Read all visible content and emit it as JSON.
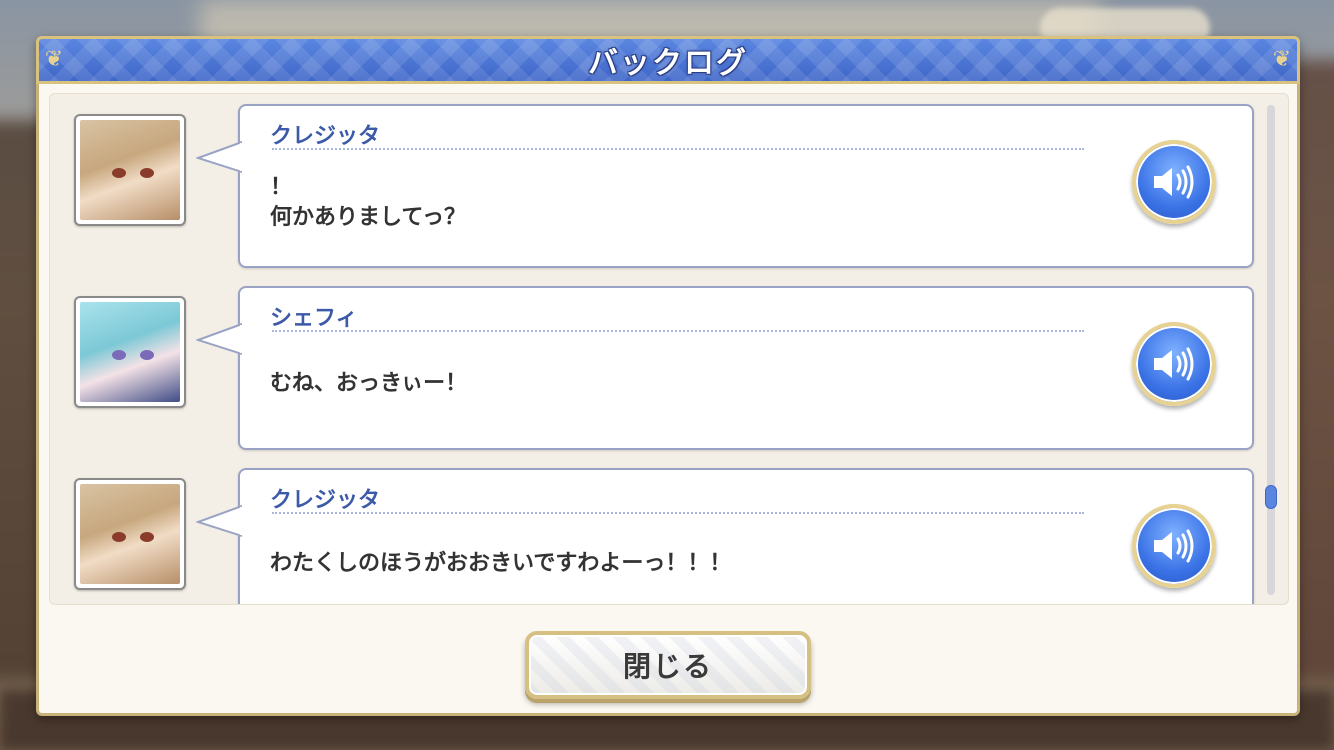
{
  "window": {
    "title": "バックログ",
    "close_label": "閉じる"
  },
  "entries": [
    {
      "speaker": "クレジッタ",
      "lines": [
        "！",
        "何かありましてっ？"
      ],
      "avatar": "kurejitta-portrait",
      "voice_icon": "speaker-icon"
    },
    {
      "speaker": "シェフィ",
      "lines": [
        "むね、おっきぃー！"
      ],
      "avatar": "shefi-portrait",
      "voice_icon": "speaker-icon"
    },
    {
      "speaker": "クレジッタ",
      "lines": [
        "わたくしのほうがおおきいですわよーっ！！！"
      ],
      "avatar": "kurejitta-portrait",
      "voice_icon": "speaker-icon"
    }
  ],
  "colors": {
    "title_bar": "#3f66c8",
    "speaker_name": "#3c5aa8",
    "voice_button": "#3a72e6",
    "frame_gold": "#c8b27a"
  }
}
